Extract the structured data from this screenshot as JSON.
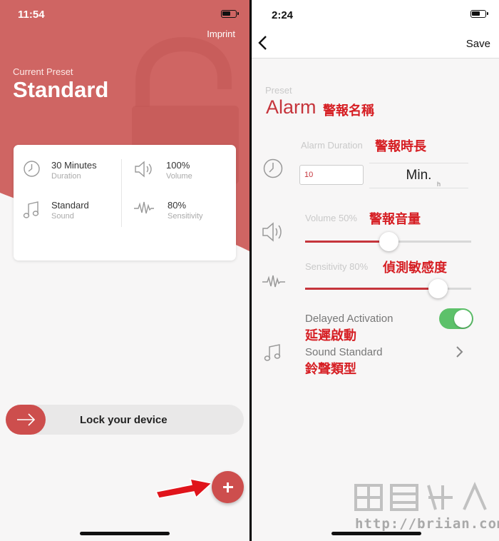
{
  "left": {
    "status_time": "11:54",
    "imprint": "Imprint",
    "current_preset_caption": "Current Preset",
    "preset_name": "Standard",
    "summary": {
      "duration": {
        "value": "30 Minutes",
        "label": "Duration",
        "icon": "clock-icon"
      },
      "volume": {
        "value": "100%",
        "label": "Volume",
        "icon": "speaker-icon"
      },
      "sound": {
        "value": "Standard",
        "label": "Sound",
        "icon": "music-note-icon"
      },
      "sensitivity": {
        "value": "80%",
        "label": "Sensitivity",
        "icon": "waveform-icon"
      }
    },
    "lock_label": "Lock your device",
    "colors": {
      "accent": "#cd4e4d",
      "hero": "#cf6563"
    }
  },
  "right": {
    "status_time": "2:24",
    "save_label": "Save",
    "preset_caption": "Preset",
    "preset_value": "Alarm",
    "alarm_duration_caption": "Alarm Duration",
    "duration_value": "10",
    "duration_unit": "Min.",
    "duration_unit_next": "h",
    "volume_caption": "Volume 50%",
    "volume_level": 0.5,
    "sensitivity_caption": "Sensitivity 80%",
    "sensitivity_level": 0.8,
    "delayed_activation_label": "Delayed Activation",
    "delayed_activation_on": true,
    "sound_label": "Sound Standard",
    "annotations": {
      "preset": "警報名稱",
      "duration": "警報時長",
      "volume": "警報音量",
      "sensitivity": "偵測敏感度",
      "delayed": "延遲啟動",
      "sound": "鈴聲類型"
    },
    "colors": {
      "accent": "#c6353c",
      "toggle": "#5dc16a",
      "annotation": "#d61f24"
    }
  },
  "watermark": "http://briian.com"
}
